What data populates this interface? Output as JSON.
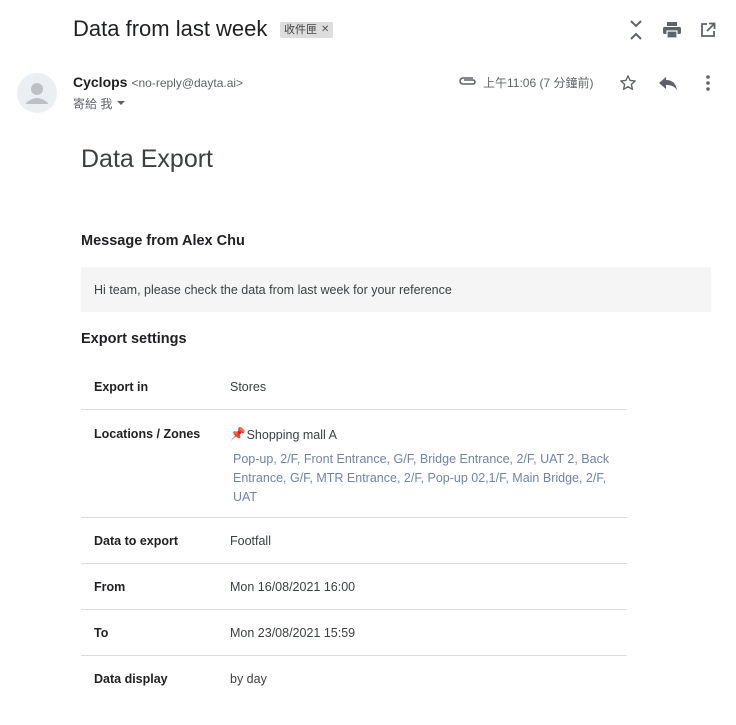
{
  "email": {
    "subject": "Data from last week",
    "label": "收件匣",
    "sender_name": "Cyclops",
    "sender_email": "<no-reply@dayta.ai>",
    "recipient": "寄給 我",
    "time": "上午11:06 (7 分鐘前)"
  },
  "body": {
    "heading": "Data Export",
    "message_title": "Message from Alex Chu",
    "message_text": "Hi team, please check the data from last week for your reference",
    "settings_title": "Export settings",
    "rows": {
      "export_in": {
        "key": "Export in",
        "value": "Stores"
      },
      "locations": {
        "key": "Locations / Zones",
        "pin": "📌",
        "location_name": "Shopping mall A",
        "zones": "Pop-up, 2/F, Front Entrance, G/F, Bridge Entrance, 2/F, UAT 2, Back Entrance, G/F, MTR Entrance, 2/F, Pop-up 02,1/F, Main Bridge, 2/F, UAT"
      },
      "data_to_export": {
        "key": "Data to export",
        "value": "Footfall"
      },
      "from": {
        "key": "From",
        "value": "Mon 16/08/2021 16:00"
      },
      "to": {
        "key": "To",
        "value": "Mon 23/08/2021 15:59"
      },
      "data_display": {
        "key": "Data display",
        "value": "by day"
      }
    }
  },
  "icons": {
    "expand": "unfold-icon",
    "print": "print-icon",
    "new_window": "open-in-new-icon",
    "attachment": "paperclip-icon",
    "star": "star-icon",
    "reply": "reply-icon",
    "more": "more-vert-icon",
    "avatar": "avatar-icon",
    "dropdown": "caret-down-icon"
  },
  "colors": {
    "zones_text": "#7283a4",
    "message_bg": "#f5f5f5",
    "icon_grey": "#5f6368"
  }
}
